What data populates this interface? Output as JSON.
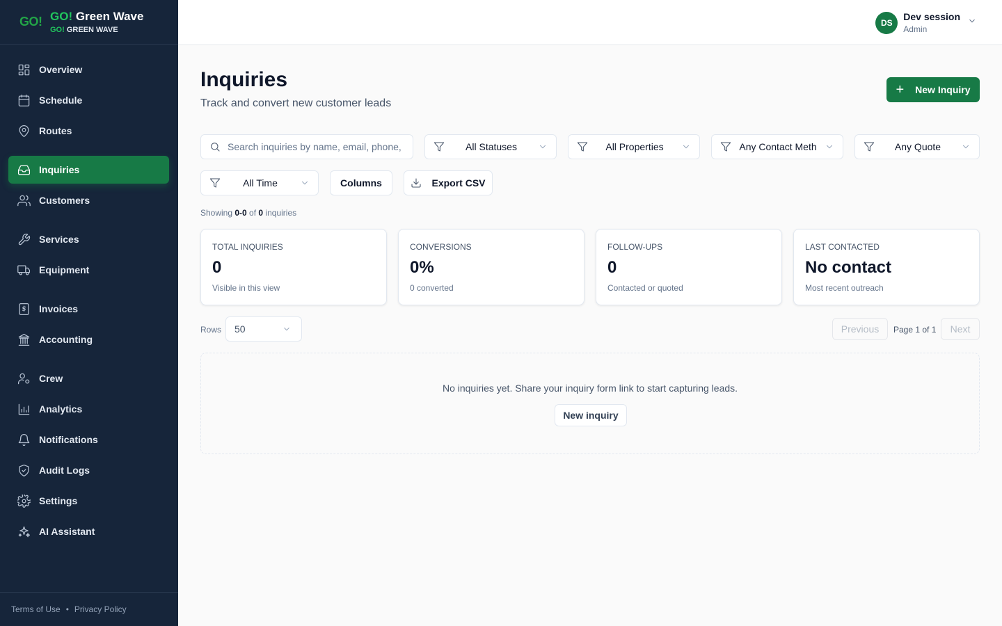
{
  "brand": {
    "logo": "GO!",
    "title_go": "GO!",
    "title_rest": " Green Wave",
    "sub_go": "GO!",
    "sub_rest": " GREEN WAVE"
  },
  "sidebar": {
    "items": [
      {
        "label": "Overview",
        "icon": "grid-icon"
      },
      {
        "label": "Schedule",
        "icon": "calendar-icon"
      },
      {
        "label": "Routes",
        "icon": "map-pin-icon"
      },
      {
        "label": "Inquiries",
        "icon": "inbox-icon",
        "active": true
      },
      {
        "label": "Customers",
        "icon": "users-icon"
      },
      {
        "label": "Services",
        "icon": "wrench-icon"
      },
      {
        "label": "Equipment",
        "icon": "truck-icon"
      },
      {
        "label": "Invoices",
        "icon": "dollar-file-icon"
      },
      {
        "label": "Accounting",
        "icon": "bank-icon"
      },
      {
        "label": "Crew",
        "icon": "user-gear-icon"
      },
      {
        "label": "Analytics",
        "icon": "bar-chart-icon"
      },
      {
        "label": "Notifications",
        "icon": "bell-icon"
      },
      {
        "label": "Audit Logs",
        "icon": "shield-check-icon"
      },
      {
        "label": "Settings",
        "icon": "gear-icon"
      },
      {
        "label": "AI Assistant",
        "icon": "sparkles-icon"
      }
    ],
    "footer": {
      "terms": "Terms of Use",
      "separator": "•",
      "privacy": "Privacy Policy"
    }
  },
  "topbar": {
    "avatar_initials": "DS",
    "user_name": "Dev session",
    "user_role": "Admin"
  },
  "header": {
    "title": "Inquiries",
    "subtitle": "Track and convert new customer leads",
    "new_button": "New Inquiry"
  },
  "filters": {
    "search_placeholder": "Search inquiries by name, email, phone, a",
    "status": "All Statuses",
    "property": "All Properties",
    "contact": "Any Contact Meth",
    "quote": "Any Quote",
    "time": "All Time",
    "columns": "Columns",
    "export": "Export CSV"
  },
  "showing": {
    "prefix": "Showing ",
    "range": "0-0",
    "of": " of ",
    "total": "0",
    "suffix": " inquiries"
  },
  "stats": [
    {
      "label": "Total Inquiries",
      "value": "0",
      "note": "Visible in this view"
    },
    {
      "label": "Conversions",
      "value": "0%",
      "note": "0 converted"
    },
    {
      "label": "Follow-ups",
      "value": "0",
      "note": "Contacted or quoted"
    },
    {
      "label": "Last Contacted",
      "value": "No contact",
      "note": "Most recent outreach"
    }
  ],
  "pagination": {
    "rows_label": "Rows",
    "rows_value": "50",
    "previous": "Previous",
    "page_text": "Page 1 of 1",
    "next": "Next"
  },
  "empty": {
    "message": "No inquiries yet. Share your inquiry form link to start capturing leads.",
    "button": "New inquiry"
  },
  "colors": {
    "sidebar_bg": "#16253a",
    "accent_green": "#177a46",
    "brand_green": "#22c55e"
  }
}
